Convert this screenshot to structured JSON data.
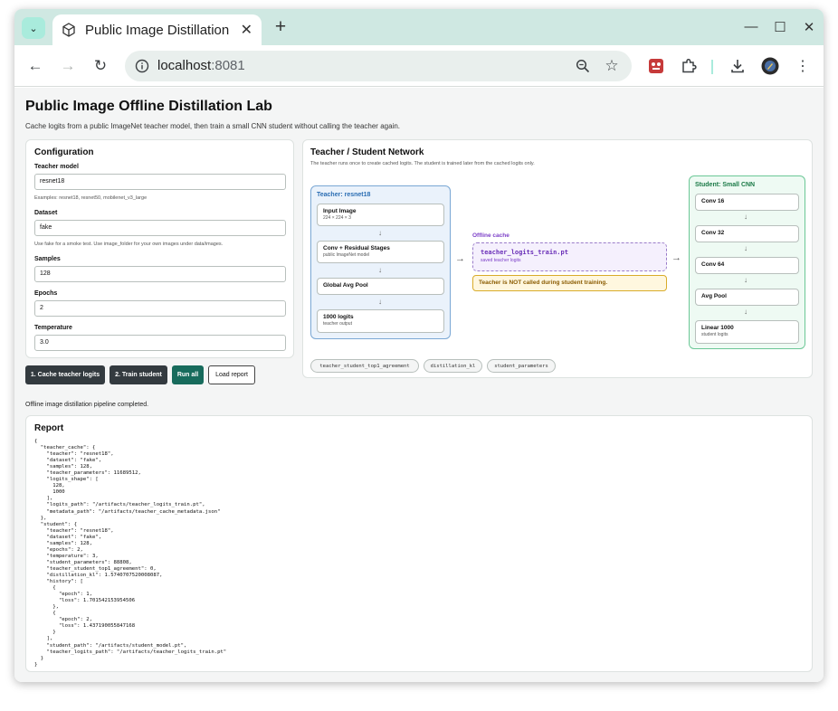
{
  "browser": {
    "tab_title": "Public Image Distillation",
    "url_host": "localhost",
    "url_port": ":8081"
  },
  "page": {
    "title": "Public Image Offline Distillation Lab",
    "subtitle": "Cache logits from a public ImageNet teacher model, then train a small CNN student without calling the teacher again."
  },
  "config": {
    "title": "Configuration",
    "teacher_model_label": "Teacher model",
    "teacher_model_value": "resnet18",
    "teacher_model_hint": "Examples: resnet18, resnet50, mobilenet_v3_large",
    "dataset_label": "Dataset",
    "dataset_value": "fake",
    "dataset_hint": "Use fake for a smoke test. Use image_folder for your own images under data/images.",
    "samples_label": "Samples",
    "samples_value": "128",
    "epochs_label": "Epochs",
    "epochs_value": "2",
    "temperature_label": "Temperature",
    "temperature_value": "3.0"
  },
  "actions": {
    "cache_label": "1. Cache teacher logits",
    "train_label": "2. Train student",
    "run_all_label": "Run all",
    "load_report_label": "Load report"
  },
  "status_text": "Offline image distillation pipeline completed.",
  "network": {
    "title": "Teacher / Student Network",
    "subtitle": "The teacher runs once to create cached logits. The student is trained later from the cached logits only.",
    "teacher_title": "Teacher: resnet18",
    "teacher_nodes": [
      {
        "title": "Input Image",
        "sub": "224 × 224 × 3"
      },
      {
        "title": "Conv + Residual Stages",
        "sub": "public ImageNet model"
      },
      {
        "title": "Global Avg Pool",
        "sub": ""
      },
      {
        "title": "1000 logits",
        "sub": "teacher output"
      }
    ],
    "cache_title": "Offline cache",
    "cache_file": "teacher_logits_train.pt",
    "cache_sub": "saved teacher logits",
    "warning": "Teacher is NOT called during student training.",
    "student_title": "Student: Small CNN",
    "student_nodes": [
      {
        "title": "Conv 16",
        "sub": ""
      },
      {
        "title": "Conv 32",
        "sub": ""
      },
      {
        "title": "Conv 64",
        "sub": ""
      },
      {
        "title": "Avg Pool",
        "sub": ""
      },
      {
        "title": "Linear 1000",
        "sub": "student logits"
      }
    ],
    "chips": [
      "teacher_student_top1_agreement",
      "distillation_kl",
      "student_parameters"
    ]
  },
  "report": {
    "title": "Report",
    "json_text": "{\n  \"teacher_cache\": {\n    \"teacher\": \"resnet18\",\n    \"dataset\": \"fake\",\n    \"samples\": 128,\n    \"teacher_parameters\": 11689512,\n    \"logits_shape\": [\n      128,\n      1000\n    ],\n    \"logits_path\": \"/artifacts/teacher_logits_train.pt\",\n    \"metadata_path\": \"/artifacts/teacher_cache_metadata.json\"\n  },\n  \"student\": {\n    \"teacher\": \"resnet18\",\n    \"dataset\": \"fake\",\n    \"samples\": 128,\n    \"epochs\": 2,\n    \"temperature\": 3,\n    \"student_parameters\": 88808,\n    \"teacher_student_top1_agreement\": 0,\n    \"distillation_kl\": 1.5740707520008087,\n    \"history\": [\n      {\n        \"epoch\": 1,\n        \"loss\": 1.701542153954506\n      },\n      {\n        \"epoch\": 2,\n        \"loss\": 1.437190055847168\n      }\n    ],\n    \"student_path\": \"/artifacts/student_model.pt\",\n    \"teacher_logits_path\": \"/artifacts/teacher_logits_train.pt\"\n  }\n}"
  }
}
